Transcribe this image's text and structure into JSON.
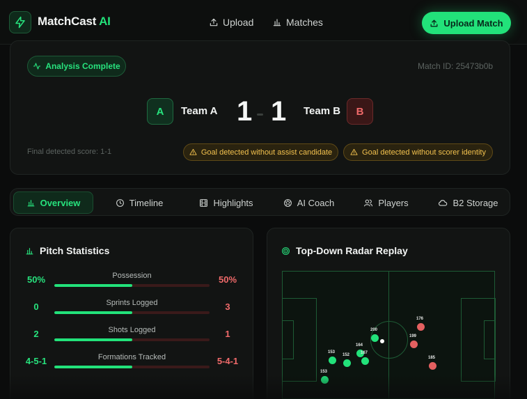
{
  "app": {
    "name": "MatchCast",
    "name_suffix": "AI"
  },
  "nav": {
    "upload": "Upload",
    "matches": "Matches",
    "upload_match_button": "Upload Match"
  },
  "analysis": {
    "status": "Analysis Complete",
    "match_id": "Match ID: 25473b0b",
    "team_a": {
      "badge": "A",
      "name": "Team A",
      "score": "1"
    },
    "team_b": {
      "badge": "B",
      "name": "Team B",
      "score": "1"
    },
    "final_score": "Final detected score: 1-1",
    "warnings": [
      "Goal detected without assist candidate",
      "Goal detected without scorer identity"
    ]
  },
  "tabs": [
    {
      "label": "Overview",
      "icon": "bar-chart-icon"
    },
    {
      "label": "Timeline",
      "icon": "clock-icon"
    },
    {
      "label": "Highlights",
      "icon": "film-icon"
    },
    {
      "label": "AI Coach",
      "icon": "ball-icon"
    },
    {
      "label": "Players",
      "icon": "users-icon"
    },
    {
      "label": "B2 Storage",
      "icon": "cloud-icon"
    }
  ],
  "stats": {
    "title": "Pitch Statistics",
    "rows": [
      {
        "label": "Possession",
        "left": "50%",
        "right": "50%",
        "fill": 0.5
      },
      {
        "label": "Sprints Logged",
        "left": "0",
        "right": "3",
        "fill": 0.5
      },
      {
        "label": "Shots Logged",
        "left": "2",
        "right": "1",
        "fill": 0.5
      },
      {
        "label": "Formations Tracked",
        "left": "4-5-1",
        "right": "5-4-1",
        "fill": 0.5
      }
    ]
  },
  "radar": {
    "title": "Top-Down Radar Replay",
    "players": [
      {
        "id": "200",
        "team": "a"
      },
      {
        "id": "153",
        "team": "a"
      },
      {
        "id": "152",
        "team": "a"
      },
      {
        "id": "164",
        "team": "a"
      },
      {
        "id": "167",
        "team": "a"
      },
      {
        "id": "153",
        "team": "a"
      },
      {
        "id": "176",
        "team": "b"
      },
      {
        "id": "199",
        "team": "b"
      },
      {
        "id": "185",
        "team": "b"
      }
    ]
  },
  "colors": {
    "accent": "#22e27a",
    "team_b": "#e46060",
    "warning": "#f2c14e"
  }
}
